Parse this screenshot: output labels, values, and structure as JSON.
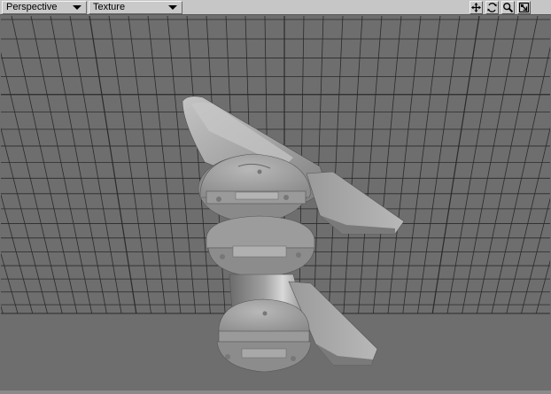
{
  "viewport": {
    "view_type": "Perspective",
    "render_style": "Texture"
  },
  "toolbar_icons": [
    "move-arrows-icon",
    "rotate-icon",
    "magnifier-icon",
    "maximize-icon"
  ],
  "colors": {
    "background": "#6e6e6e",
    "grid_line": "#2a2a2a",
    "model_surface": "#a8a8a8",
    "titlebar": "#c6c6c6"
  }
}
